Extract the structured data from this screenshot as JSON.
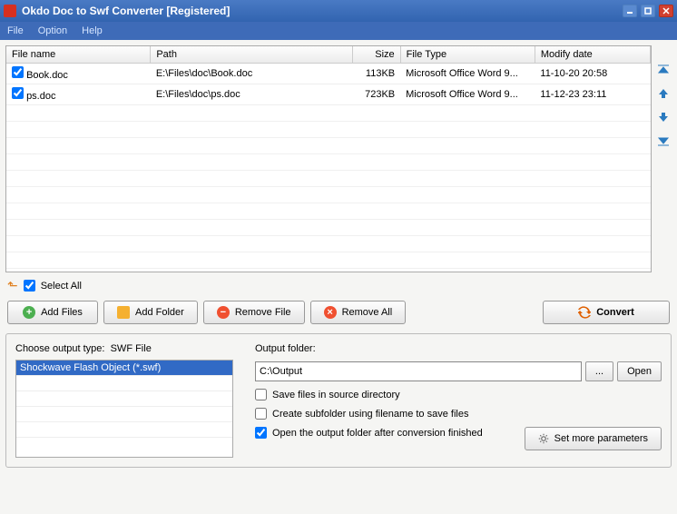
{
  "window": {
    "title": "Okdo Doc to Swf Converter [Registered]"
  },
  "menu": {
    "file": "File",
    "option": "Option",
    "help": "Help"
  },
  "table": {
    "headers": {
      "name": "File name",
      "path": "Path",
      "size": "Size",
      "type": "File Type",
      "date": "Modify date"
    },
    "rows": [
      {
        "name": "Book.doc",
        "path": "E:\\Files\\doc\\Book.doc",
        "size": "113KB",
        "type": "Microsoft Office Word 9...",
        "date": "11-10-20 20:58"
      },
      {
        "name": "ps.doc",
        "path": "E:\\Files\\doc\\ps.doc",
        "size": "723KB",
        "type": "Microsoft Office Word 9...",
        "date": "11-12-23 23:11"
      }
    ]
  },
  "selectAll": "Select All",
  "buttons": {
    "addFiles": "Add Files",
    "addFolder": "Add Folder",
    "removeFile": "Remove File",
    "removeAll": "Remove All",
    "convert": "Convert"
  },
  "output": {
    "typeLabel": "Choose output type:",
    "typeValue": "SWF File",
    "typeOption": "Shockwave Flash Object (*.swf)",
    "folderLabel": "Output folder:",
    "folderValue": "C:\\Output",
    "browse": "...",
    "open": "Open",
    "saveSource": "Save files in source directory",
    "createSub": "Create subfolder using filename to save files",
    "openAfter": "Open the output folder after conversion finished",
    "moreParams": "Set more parameters"
  }
}
